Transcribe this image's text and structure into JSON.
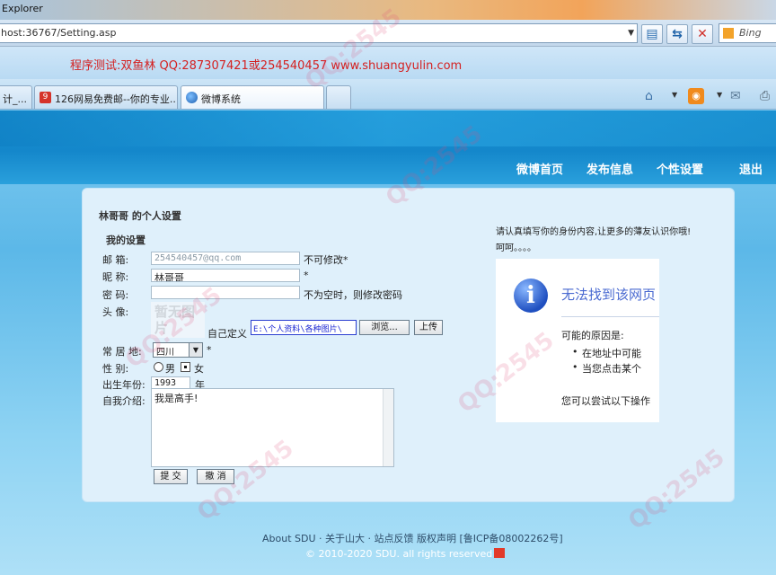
{
  "browser": {
    "title": "Explorer",
    "url": "host:36767/Setting.asp",
    "search_label": "Bing",
    "promo_text": "程序测试:双鱼林 QQ:287307421或254540457 www.shuangyulin.com",
    "tabs": [
      {
        "label": "计_..."
      },
      {
        "label": "126网易免费邮--你的专业..."
      },
      {
        "label": "微博系统"
      }
    ]
  },
  "nav": {
    "home": "微博首页",
    "post": "发布信息",
    "settings": "个性设置",
    "logout": "退出"
  },
  "form": {
    "page_heading": "林哥哥 的个人设置",
    "section_heading": "我的设置",
    "email_label": "邮 箱:",
    "email_value": "254540457@qq.com",
    "email_note": "不可修改*",
    "nickname_label": "昵 称:",
    "nickname_value": "林哥哥",
    "nickname_note": "*",
    "password_label": "密 码:",
    "password_note": "不为空时，则修改密码",
    "avatar_label": "头 像:",
    "avatar_placeholder": "暂无图片",
    "custom_label": "自己定义",
    "file_path": "E:\\个人资料\\各种图片\\",
    "browse_label": "浏览...",
    "upload_label": "上传",
    "region_label": "常 居 地:",
    "region_value": "四川",
    "region_note": "*",
    "gender_label": "性 别:",
    "gender_male": "男",
    "gender_female": "女",
    "birth_label": "出生年份:",
    "birth_value": "1993",
    "birth_unit": "年",
    "bio_label": "自我介绍:",
    "bio_value": "我是高手!",
    "submit_label": "提 交",
    "cancel_label": "撤 消"
  },
  "sidebar": {
    "text": "请认真填写你的身份内容,让更多的薄友认识你哦! 呵呵。。。。",
    "error_title": "无法找到该网页",
    "error_reason": "可能的原因是:",
    "error_items": [
      "在地址中可能",
      "当您点击某个"
    ],
    "error_try": "您可以尝试以下操作"
  },
  "footer": {
    "links": "About SDU · 关于山大 · 站点反馈 版权声明 [鲁ICP备08002262号]",
    "copyright": "© 2010-2020 SDU. all rights reserved"
  },
  "colors": {
    "banner": "#1487cb",
    "panel": "#dff0fb",
    "promo": "#d42020"
  }
}
